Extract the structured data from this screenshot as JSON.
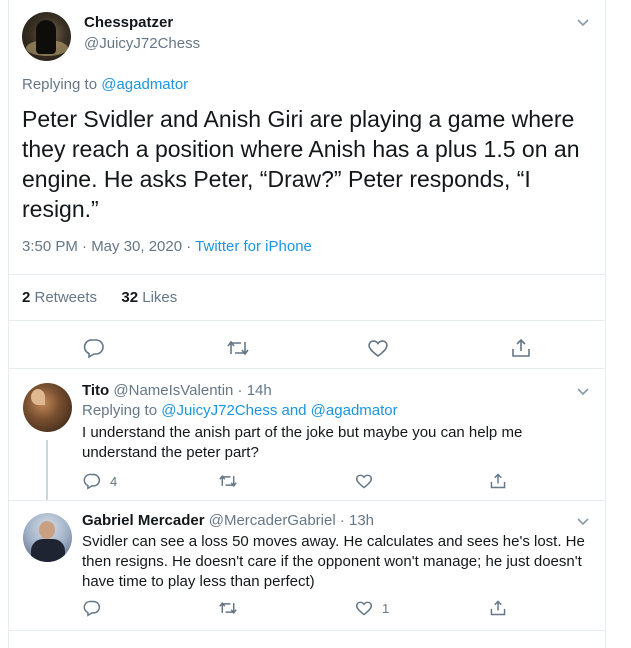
{
  "main_tweet": {
    "name": "Chesspatzer",
    "handle": "@JuicyJ72Chess",
    "replying_prefix": "Replying to ",
    "replying_to": "@agadmator",
    "text": "Peter Svidler and Anish Giri are playing a game where they reach a position where Anish has a plus 1.5 on an engine. He asks Peter, “Draw?” Peter responds, “I resign.”",
    "timestamp": "3:50 PM · May 30, 2020 · ",
    "source": "Twitter for iPhone",
    "retweets_count": "2",
    "retweets_label": " Retweets",
    "likes_count": "32",
    "likes_label": " Likes"
  },
  "replies": [
    {
      "name": "Tito",
      "handle": " @NameIsValentin · 14h",
      "replying_prefix": "Replying to ",
      "replying_to": "@JuicyJ72Chess and @agadmator",
      "text": "I understand the anish part of the joke but maybe you can help me understand the peter part?",
      "reply_count": "4",
      "like_count": ""
    },
    {
      "name": "Gabriel Mercader",
      "handle": " @MercaderGabriel · 13h",
      "text": "Svidler can see a loss 50 moves away. He calculates and sees he's lost. He then resigns. He doesn't care if the opponent won't manage; he just doesn't have time to play less than perfect)",
      "reply_count": "",
      "like_count": "1"
    }
  ],
  "icons": {
    "reply": "reply-icon",
    "retweet": "retweet-icon",
    "like": "heart-icon",
    "share": "share-icon",
    "more": "chevron-down-icon"
  },
  "colors": {
    "link": "#1b95e0",
    "muted": "#657786",
    "border": "#e6ecf0"
  }
}
